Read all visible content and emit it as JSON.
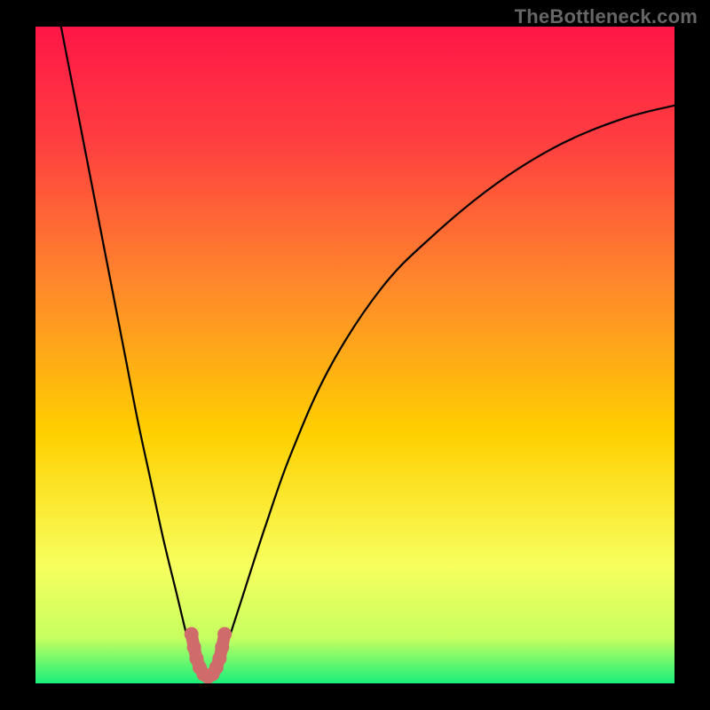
{
  "watermark": "TheBottleneck.com",
  "chart_data": {
    "type": "line",
    "title": "",
    "xlabel": "",
    "ylabel": "",
    "xlim": [
      0,
      100
    ],
    "ylim": [
      0,
      100
    ],
    "grid": false,
    "legend": false,
    "colors": {
      "gradient_top": "#ff1647",
      "gradient_mid_upper": "#ff7a2a",
      "gradient_mid": "#ffd500",
      "gradient_lower": "#f7ff66",
      "gradient_bottom": "#19f07a",
      "curve": "#000000",
      "marker": "#cf6b6b"
    },
    "background_gradient_stops": [
      {
        "offset": 0.0,
        "color": "#ff1647"
      },
      {
        "offset": 0.18,
        "color": "#ff4040"
      },
      {
        "offset": 0.4,
        "color": "#ff8a2a"
      },
      {
        "offset": 0.62,
        "color": "#ffd000"
      },
      {
        "offset": 0.82,
        "color": "#f7ff5e"
      },
      {
        "offset": 0.93,
        "color": "#c8ff60"
      },
      {
        "offset": 1.0,
        "color": "#19f07a"
      }
    ],
    "series": [
      {
        "name": "bottleneck-curve",
        "x": [
          4,
          6,
          8,
          10,
          12,
          14,
          16,
          18,
          20,
          22,
          24,
          25,
          26,
          27,
          28,
          29,
          30,
          32,
          36,
          40,
          46,
          54,
          62,
          72,
          82,
          92,
          100
        ],
        "y": [
          100,
          90,
          80,
          70,
          60,
          50,
          40,
          31,
          22,
          14,
          6,
          3,
          1.5,
          1,
          1.5,
          3,
          6,
          12,
          24,
          35,
          48,
          60,
          68,
          76,
          82,
          86,
          88
        ]
      }
    ],
    "minimum_marker": {
      "x_range": [
        24.2,
        29.8
      ],
      "y_range": [
        1.0,
        8.0
      ],
      "points": [
        {
          "x": 24.4,
          "y": 7.5
        },
        {
          "x": 24.8,
          "y": 5.5
        },
        {
          "x": 25.2,
          "y": 3.8
        },
        {
          "x": 25.7,
          "y": 2.4
        },
        {
          "x": 26.3,
          "y": 1.4
        },
        {
          "x": 27.0,
          "y": 1.0
        },
        {
          "x": 27.7,
          "y": 1.4
        },
        {
          "x": 28.3,
          "y": 2.4
        },
        {
          "x": 28.8,
          "y": 3.8
        },
        {
          "x": 29.2,
          "y": 5.5
        },
        {
          "x": 29.6,
          "y": 7.5
        }
      ]
    }
  }
}
